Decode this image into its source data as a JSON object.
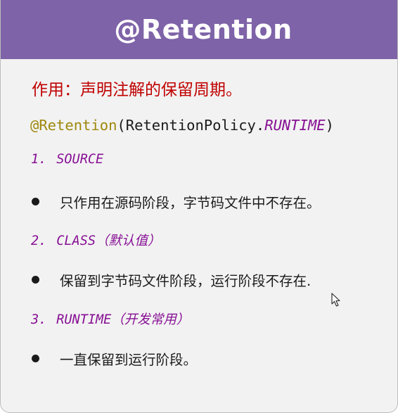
{
  "header": {
    "title": "@Retention"
  },
  "purpose": "作用：声明注解的保留周期。",
  "code": {
    "annotation": "@Retention",
    "open_paren": "(",
    "policy_class": "RetentionPolicy.",
    "policy_value": "RUNTIME",
    "close_paren": ")"
  },
  "items": [
    {
      "number": "1.",
      "name": "SOURCE",
      "note": "",
      "description": "只作用在源码阶段，字节码文件中不存在。"
    },
    {
      "number": "2.",
      "name": "CLASS",
      "note": "（默认值）",
      "description": "保留到字节码文件阶段，运行阶段不存在."
    },
    {
      "number": "3.",
      "name": "RUNTIME",
      "note": "（开发常用）",
      "description": "一直保留到运行阶段。"
    }
  ],
  "colors": {
    "header_bg": "#7e63a8",
    "purpose_text": "#c00000",
    "annotation": "#9e880d",
    "constant": "#871094"
  },
  "icons": {
    "cursor": "mouse-pointer-icon",
    "bullet": "bullet-dot-icon"
  }
}
